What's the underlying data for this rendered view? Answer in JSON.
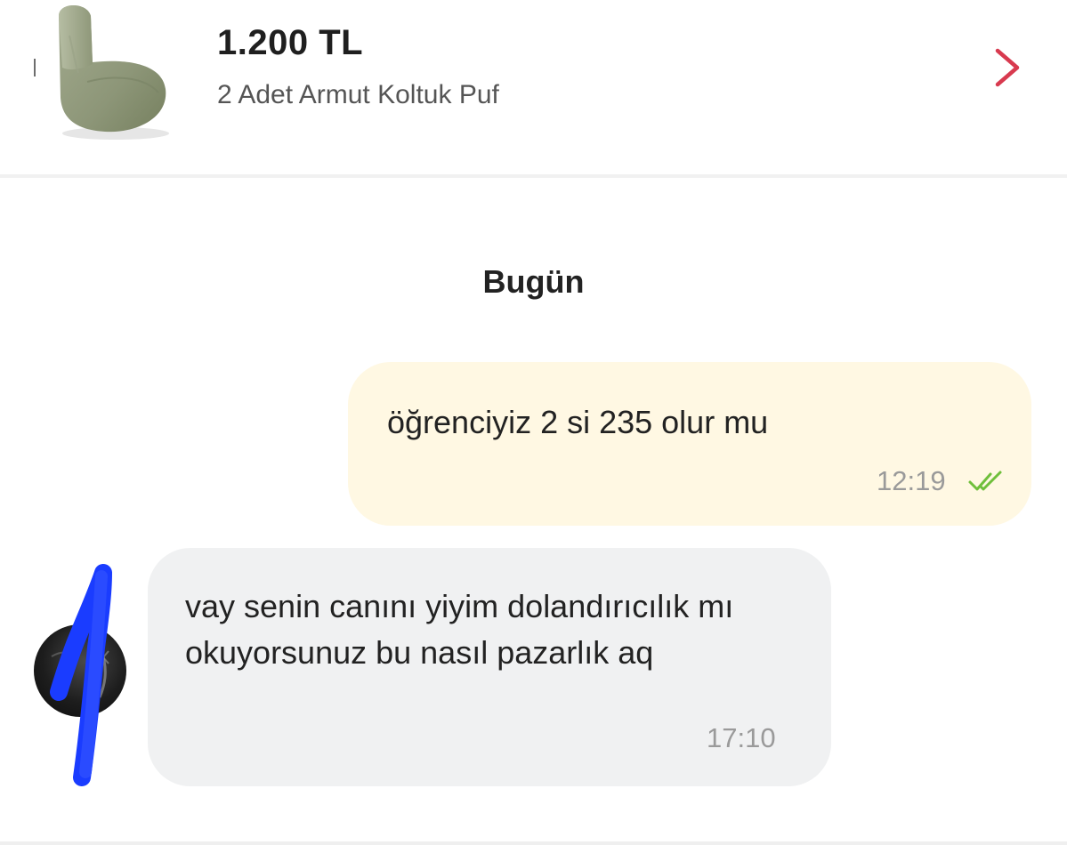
{
  "product": {
    "price": "1.200 TL",
    "title": "2 Adet Armut Koltuk Puf",
    "thumbnail_icon": "bean-bag-chair-image",
    "open_icon": "chevron-right-icon"
  },
  "conversation": {
    "date_separator": "Bugün",
    "messages": [
      {
        "direction": "outgoing",
        "text": "öğrenciyiz 2 si 235 olur mu",
        "time": "12:19",
        "status_icon": "double-check-icon"
      },
      {
        "direction": "incoming",
        "text": "vay senin canını yiyim dolandırıcılık mı okuyorsunuz bu nasıl pazarlık aq",
        "time": "17:10",
        "avatar_icon": "avatar"
      }
    ]
  },
  "colors": {
    "chevron": "#d83a4f",
    "outgoing_bubble": "#fff8e3",
    "incoming_bubble": "#f0f1f2",
    "read_receipt": "#6fbf3b",
    "timestamp": "#9a9a9a",
    "redaction_mark": "#1a3cff"
  }
}
